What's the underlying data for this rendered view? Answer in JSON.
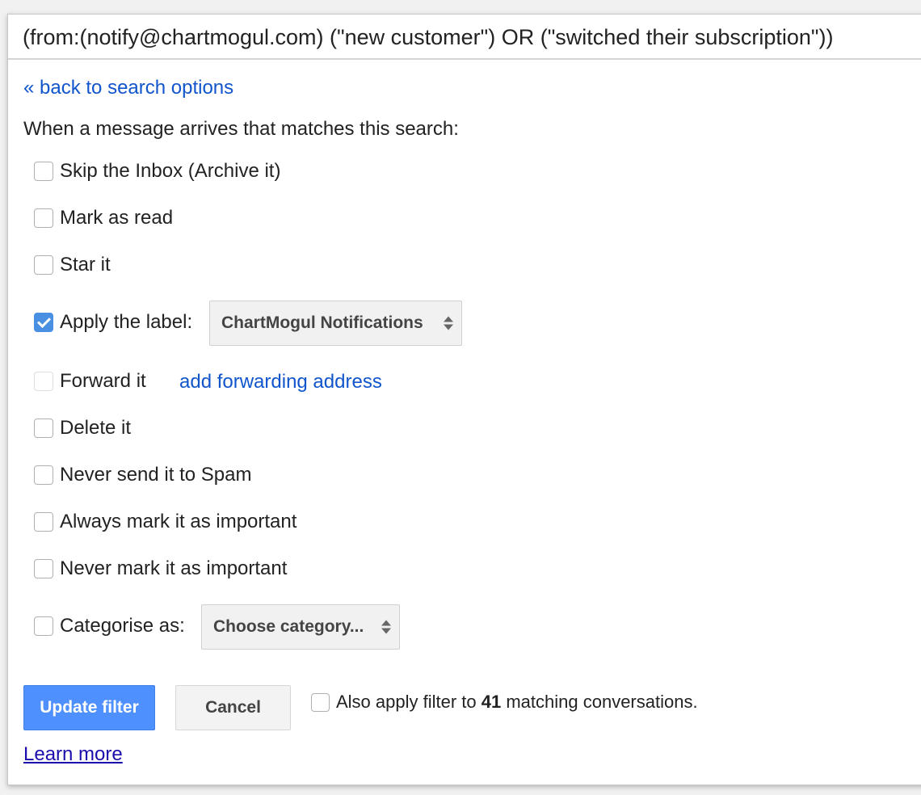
{
  "search": {
    "query": "(from:(notify@chartmogul.com) (\"new customer\") OR (\"switched their subscription\"))"
  },
  "back_link": "« back to search options",
  "intro": "When a message arrives that matches this search:",
  "actions": [
    {
      "label": "Skip the Inbox (Archive it)",
      "checked": false
    },
    {
      "label": "Mark as read",
      "checked": false
    },
    {
      "label": "Star it",
      "checked": false
    },
    {
      "label": "Apply the label:",
      "checked": true,
      "select": "ChartMogul Notifications"
    },
    {
      "label": "Forward it",
      "checked": false,
      "disabled": true,
      "link": "add forwarding address"
    },
    {
      "label": "Delete it",
      "checked": false
    },
    {
      "label": "Never send it to Spam",
      "checked": false
    },
    {
      "label": "Always mark it as important",
      "checked": false
    },
    {
      "label": "Never mark it as important",
      "checked": false
    },
    {
      "label": "Categorise as:",
      "checked": false,
      "select": "Choose category..."
    }
  ],
  "buttons": {
    "update": "Update filter",
    "cancel": "Cancel"
  },
  "also_apply": {
    "prefix": "Also apply filter to ",
    "count": "41",
    "suffix": " matching conversations.",
    "checked": false
  },
  "learn_more": "Learn more",
  "colors": {
    "primary": "#4d90fe",
    "link": "#1155cc",
    "checkbox_checked": "#4a90e2"
  }
}
